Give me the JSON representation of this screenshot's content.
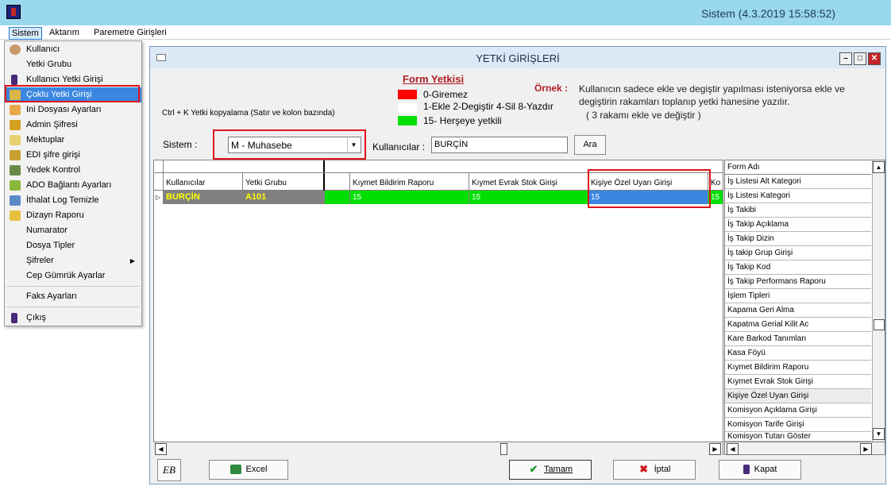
{
  "app": {
    "title": "Sistem (4.3.2019 15:58:52)"
  },
  "menubar": {
    "items": [
      "Sistem",
      "Aktarım",
      "Paremetre Girişleri"
    ]
  },
  "dropdown": {
    "items": [
      {
        "label": "Kullanıcı",
        "icon": "user-icon"
      },
      {
        "label": "Yetki Grubu",
        "icon": ""
      },
      {
        "label": "Kullanıcı Yetki Girişi",
        "icon": "door-icon"
      },
      {
        "label": "Çoklu Yetki Girişi",
        "icon": "keys-icon",
        "selected": true
      },
      {
        "label": "Ini Dosyası Ayarları",
        "icon": "file-icon"
      },
      {
        "label": "Admin Şifresi",
        "icon": "key-icon"
      },
      {
        "label": "Mektuplar",
        "icon": "letter-icon"
      },
      {
        "label": "EDI şifre girişi",
        "icon": "key-icon"
      },
      {
        "label": "Yedek Kontrol",
        "icon": "backup-icon"
      },
      {
        "label": "ADO Bağlantı Ayarları",
        "icon": "connection-icon"
      },
      {
        "label": "İthalat Log Temizle",
        "icon": "log-icon"
      },
      {
        "label": "Dizayn Raporu",
        "icon": "report-icon"
      },
      {
        "label": "Numarator",
        "icon": ""
      },
      {
        "label": "Dosya Tipler",
        "icon": ""
      },
      {
        "label": "Şifreler",
        "icon": "",
        "submenu": true
      },
      {
        "label": "Cep Gümrük Ayarlar",
        "icon": ""
      },
      {
        "label": "Faks Ayarları",
        "icon": ""
      },
      {
        "label": "Çıkış",
        "icon": "exit-icon"
      }
    ]
  },
  "window": {
    "title": "YETKİ GİRİŞLERİ",
    "form_yetkisi": {
      "title": "Form Yetkisi",
      "legend": [
        {
          "label": "0-Giremez",
          "color": "#ff0000"
        },
        {
          "label": "1-Ekle  2-Degiştir  4-Sil  8-Yazdır",
          "color": "#ffffff"
        },
        {
          "label": "15- Herşeye yetkili",
          "color": "#00e000"
        }
      ]
    },
    "ornek": {
      "label": "Örnek :",
      "text": "Kullanıcın sadece ekle ve degiştir yapılması isteniyorsa  ekle ve degiştirin rakamları toplanıp yetki hanesine yazılır.",
      "sub": "( 3 rakamı ekle ve değiştir )"
    },
    "ctrl_hint": "Ctrl + K Yetki kopyalama (Satır ve kolon bazında)",
    "sistem": {
      "label": "Sistem :",
      "value": "M - Muhasebe"
    },
    "kullanicilar": {
      "label": "Kullanıcılar :",
      "value": "BURÇİN"
    },
    "ara_label": "Ara",
    "grid": {
      "columns": [
        "Kullanıcılar",
        "Yetki Grubu",
        "Kıymet Bildirim Raporu",
        "Kıymet Evrak Stok Girişi",
        "Kişiye Özel Uyarı Girişi",
        "Ko"
      ],
      "row": {
        "user": "BURÇİN",
        "group": "A101",
        "values": [
          "15",
          "15",
          "15",
          "15"
        ]
      }
    },
    "form_list": {
      "header": "Form Adı",
      "items": [
        "İş Listesi Alt Kategori",
        "İş Listesi Kategori",
        "İş Takibi",
        "İş Takip Açıklama",
        "İş Takip Dizin",
        "İş takip Grup Girişi",
        "İş Takip Kod",
        "İş Takip Performans Raporu",
        "İşlem Tipleri",
        "Kapama Geri Alma",
        "Kapatma Gerial Kilit Ac",
        "Kare Barkod Tanımları",
        "Kasa Föyü",
        "Kıymet Bildirim Raporu",
        "Kıymet Evrak Stok Girişi",
        "Kişiye Özel Uyarı Girişi",
        "Komisyon Açıklama Girişi",
        "Komisyon Tarife Girişi",
        "Komisyon Tutarı Göster"
      ]
    },
    "toolbar": {
      "eb": "EB",
      "excel": "Excel",
      "tamam": "Tamam",
      "iptal": "İptal",
      "kapat": "Kapat"
    }
  }
}
